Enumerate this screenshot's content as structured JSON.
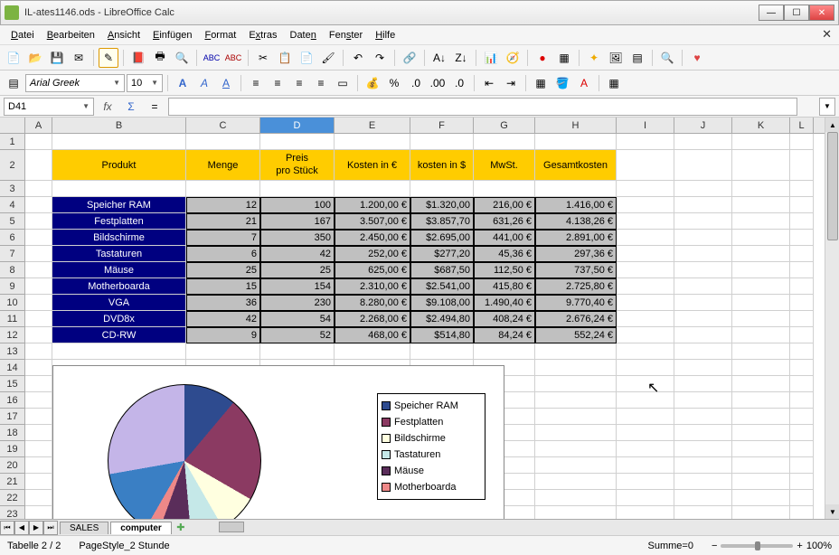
{
  "window": {
    "title": "IL-ates1146.ods - LibreOffice Calc"
  },
  "menu": {
    "datei": "Datei",
    "bearbeiten": "Bearbeiten",
    "ansicht": "Ansicht",
    "einfugen": "Einfügen",
    "format": "Format",
    "extras": "Extras",
    "daten": "Daten",
    "fenster": "Fenster",
    "hilfe": "Hilfe"
  },
  "format_bar": {
    "font": "Arial Greek",
    "size": "10"
  },
  "fx": {
    "cell": "D41"
  },
  "cols": [
    "A",
    "B",
    "C",
    "D",
    "E",
    "F",
    "G",
    "H",
    "I",
    "J",
    "K",
    "L"
  ],
  "headers": {
    "produkt": "Produkt",
    "menge": "Menge",
    "preis": "Preis\npro Stück",
    "kosten_e": "Kosten in €",
    "kosten_d": "kosten in $",
    "mwst": "MwSt.",
    "gesamt": "Gesamtkosten"
  },
  "rows": [
    {
      "n": 4,
      "p": "Speicher RAM",
      "m": "12",
      "pp": "100",
      "ke": "1.200,00 €",
      "kd": "$1.320,00",
      "mw": "216,00 €",
      "g": "1.416,00 €"
    },
    {
      "n": 5,
      "p": "Festplatten",
      "m": "21",
      "pp": "167",
      "ke": "3.507,00 €",
      "kd": "$3.857,70",
      "mw": "631,26 €",
      "g": "4.138,26 €"
    },
    {
      "n": 6,
      "p": "Bildschirme",
      "m": "7",
      "pp": "350",
      "ke": "2.450,00 €",
      "kd": "$2.695,00",
      "mw": "441,00 €",
      "g": "2.891,00 €"
    },
    {
      "n": 7,
      "p": "Tastaturen",
      "m": "6",
      "pp": "42",
      "ke": "252,00 €",
      "kd": "$277,20",
      "mw": "45,36 €",
      "g": "297,36 €"
    },
    {
      "n": 8,
      "p": "Mäuse",
      "m": "25",
      "pp": "25",
      "ke": "625,00 €",
      "kd": "$687,50",
      "mw": "112,50 €",
      "g": "737,50 €"
    },
    {
      "n": 9,
      "p": "Motherboarda",
      "m": "15",
      "pp": "154",
      "ke": "2.310,00 €",
      "kd": "$2.541,00",
      "mw": "415,80 €",
      "g": "2.725,80 €"
    },
    {
      "n": 10,
      "p": "VGA",
      "m": "36",
      "pp": "230",
      "ke": "8.280,00 €",
      "kd": "$9.108,00",
      "mw": "1.490,40 €",
      "g": "9.770,40 €"
    },
    {
      "n": 11,
      "p": "DVD8x",
      "m": "42",
      "pp": "54",
      "ke": "2.268,00 €",
      "kd": "$2.494,80",
      "mw": "408,24 €",
      "g": "2.676,24 €"
    },
    {
      "n": 12,
      "p": "CD-RW",
      "m": "9",
      "pp": "52",
      "ke": "468,00 €",
      "kd": "$514,80",
      "mw": "84,24 €",
      "g": "552,24 €"
    }
  ],
  "legend": [
    "Speicher RAM",
    "Festplatten",
    "Bildschirme",
    "Tastaturen",
    "Mäuse",
    "Motherboarda"
  ],
  "legend_colors": [
    "#2e4b8f",
    "#8b3a62",
    "#ffffe0",
    "#c5e8e8",
    "#5a2d5a",
    "#e88"
  ],
  "tabs": {
    "t1": "SALES",
    "t2": "computer"
  },
  "status": {
    "sheet": "Tabelle 2 / 2",
    "style": "PageStyle_2 Stunde",
    "sum": "Summe=0",
    "zoom": "100%"
  },
  "chart_data": {
    "type": "pie",
    "title": "",
    "categories": [
      "Speicher RAM",
      "Festplatten",
      "Bildschirme",
      "Tastaturen",
      "Mäuse",
      "Motherboarda",
      "VGA",
      "DVD8x",
      "CD-RW"
    ],
    "values": [
      1200,
      3507,
      2450,
      252,
      625,
      2310,
      8280,
      2268,
      468
    ],
    "colors": [
      "#2e4b8f",
      "#8b3a62",
      "#ffffe0",
      "#c5e8e8",
      "#5a2d5a",
      "#e88",
      "#3a7fc4",
      "#c4b5e8",
      "#2e4b8f"
    ]
  }
}
